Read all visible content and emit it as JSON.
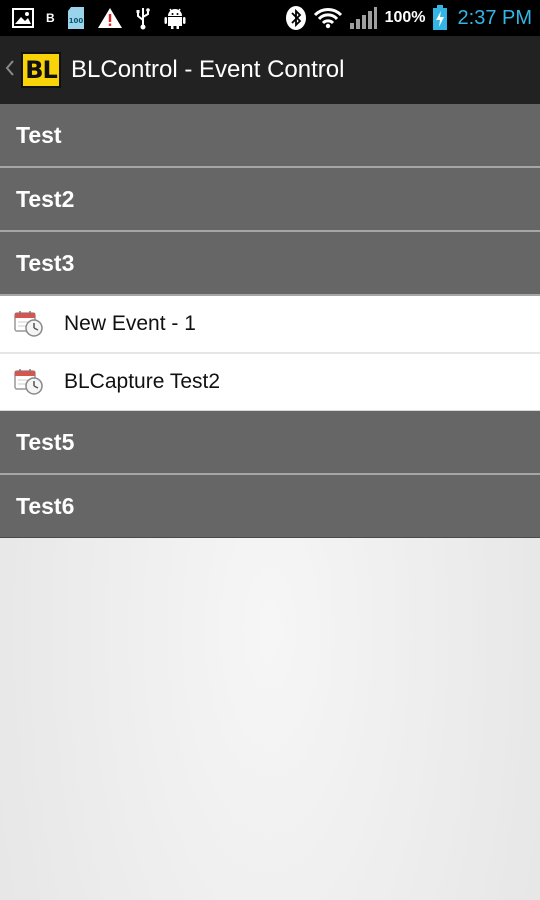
{
  "status_bar": {
    "left_icons": [
      "image-icon",
      "b-icon",
      "sd-card-icon",
      "warning-icon",
      "usb-icon",
      "android-icon"
    ],
    "b_label": "B",
    "sd_label": "100",
    "right_icons": [
      "bluetooth-icon",
      "wifi-icon",
      "signal-icon",
      "battery-charging-icon"
    ],
    "battery_percent": "100%",
    "time": "2:37 PM",
    "time_color": "#33b5e5"
  },
  "action_bar": {
    "logo_text": "BL",
    "title": "BLControl - Event Control",
    "logo_color": "#f7d308"
  },
  "groups": [
    {
      "label": "Test",
      "expanded": false,
      "children": []
    },
    {
      "label": "Test2",
      "expanded": false,
      "children": []
    },
    {
      "label": "Test3",
      "expanded": true,
      "children": [
        {
          "label": "New Event - 1",
          "icon": "calendar-clock-icon"
        },
        {
          "label": "BLCapture Test2",
          "icon": "calendar-clock-icon"
        }
      ]
    },
    {
      "label": "Test5",
      "expanded": false,
      "children": []
    },
    {
      "label": "Test6",
      "expanded": false,
      "children": []
    }
  ]
}
